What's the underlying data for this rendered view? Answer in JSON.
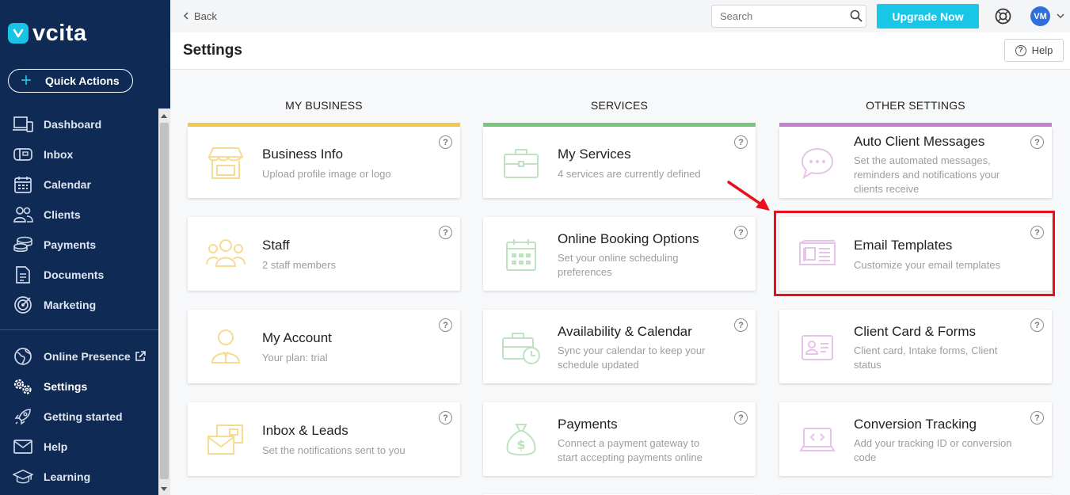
{
  "app": {
    "brand": "vcita"
  },
  "sidebar": {
    "quick_actions": "Quick Actions",
    "items": [
      {
        "label": "Dashboard",
        "icon": "dashboard-icon"
      },
      {
        "label": "Inbox",
        "icon": "inbox-icon"
      },
      {
        "label": "Calendar",
        "icon": "calendar-icon"
      },
      {
        "label": "Clients",
        "icon": "clients-icon"
      },
      {
        "label": "Payments",
        "icon": "payments-icon"
      },
      {
        "label": "Documents",
        "icon": "documents-icon"
      },
      {
        "label": "Marketing",
        "icon": "marketing-icon"
      },
      {
        "label": "Online Presence",
        "icon": "globe-icon"
      },
      {
        "label": "Settings",
        "icon": "settings-icon",
        "active": true
      },
      {
        "label": "Getting started",
        "icon": "rocket-icon"
      },
      {
        "label": "Help",
        "icon": "mail-icon"
      },
      {
        "label": "Learning",
        "icon": "graduation-cap-icon"
      }
    ]
  },
  "topbar": {
    "back": "Back",
    "search_placeholder": "Search",
    "upgrade": "Upgrade Now",
    "avatar_initials": "VM"
  },
  "header": {
    "title": "Settings",
    "help": "Help"
  },
  "columns": [
    {
      "title": "MY BUSINESS",
      "accent": "#f2c94c",
      "cards": [
        {
          "title": "Business Info",
          "desc": "Upload profile image or logo"
        },
        {
          "title": "Staff",
          "desc": "2 staff members"
        },
        {
          "title": "My Account",
          "desc": "Your plan: trial"
        },
        {
          "title": "Inbox & Leads",
          "desc": "Set the notifications sent to you"
        }
      ]
    },
    {
      "title": "SERVICES",
      "accent": "#7bc67e",
      "cards": [
        {
          "title": "My Services",
          "desc": "4 services are currently defined"
        },
        {
          "title": "Online Booking Options",
          "desc": "Set your online scheduling preferences"
        },
        {
          "title": "Availability & Calendar",
          "desc": "Sync your calendar to keep your schedule updated"
        },
        {
          "title": "Payments",
          "desc": "Connect a payment gateway to start accepting payments online"
        }
      ]
    },
    {
      "title": "OTHER SETTINGS",
      "accent": "#c57fd0",
      "cards": [
        {
          "title": "Auto Client Messages",
          "desc": "Set the automated messages, reminders and notifications your clients receive"
        },
        {
          "title": "Email Templates",
          "desc": "Customize your email templates"
        },
        {
          "title": "Client Card & Forms",
          "desc": "Client card, Intake forms, Client status"
        },
        {
          "title": "Conversion Tracking",
          "desc": "Add your tracking ID or conversion code"
        }
      ]
    }
  ],
  "colors": {
    "sidebar_bg": "#0e2a55",
    "upgrade": "#19c6e6",
    "highlight": "#e8101b"
  }
}
